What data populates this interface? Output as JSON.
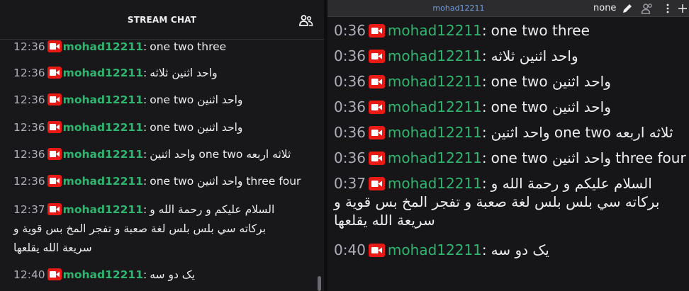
{
  "left_panel": {
    "title": "STREAM CHAT",
    "messages": [
      {
        "time": "12:36",
        "user": "mohad12211",
        "text": "one two three"
      },
      {
        "time": "12:36",
        "user": "mohad12211",
        "text": "واحد اثنين ثلاثه"
      },
      {
        "time": "12:36",
        "user": "mohad12211",
        "text": "واحد اثنين one two"
      },
      {
        "time": "12:36",
        "user": "mohad12211",
        "text": "one two واحد اثنين"
      },
      {
        "time": "12:36",
        "user": "mohad12211",
        "text": "ثلاثه اربعه one two واحد اثنين"
      },
      {
        "time": "12:36",
        "user": "mohad12211",
        "text": "one two واحد اثنين three four"
      },
      {
        "time": "12:37",
        "user": "mohad12211",
        "text": "السلام عليكم و رحمة الله و بركاته سي بلس بلس لغة صعبة و تفجر المخ بس قوية و سريعة الله يقلعها"
      },
      {
        "time": "12:40",
        "user": "mohad12211",
        "text": "یک دو سه"
      }
    ]
  },
  "right_panel": {
    "channel": "mohad12211",
    "mode": "none",
    "messages": [
      {
        "time": "0:36",
        "user": "mohad12211",
        "text": "one two three"
      },
      {
        "time": "0:36",
        "user": "mohad12211",
        "text": "واحد اثنين ثلاثه"
      },
      {
        "time": "0:36",
        "user": "mohad12211",
        "text": "واحد اثنين one two"
      },
      {
        "time": "0:36",
        "user": "mohad12211",
        "text": "one two واحد اثنين"
      },
      {
        "time": "0:36",
        "user": "mohad12211",
        "text": "ثلاثه اربعه one two واحد اثنين"
      },
      {
        "time": "0:36",
        "user": "mohad12211",
        "text": "one two واحد اثنين three four"
      },
      {
        "time": "0:37",
        "user": "mohad12211",
        "text": "السلام عليكم و رحمة الله و بركاته سي بلس بلس لغة صعبة و تفجر المخ بس قوية و سريعة الله يقلعها"
      },
      {
        "time": "0:40",
        "user": "mohad12211",
        "text": "یک دو سه"
      }
    ]
  },
  "icons": {
    "badge": "video-camera-icon",
    "users": "users-icon",
    "pencil": "pencil-icon",
    "accounts": "user-accounts-icon",
    "menu": "more-vertical-icon",
    "add": "plus-icon"
  },
  "colors": {
    "username": "#2fb570",
    "badge": "#e91916",
    "timestamp": "#adadb8",
    "channel": "#6fa0e0"
  }
}
